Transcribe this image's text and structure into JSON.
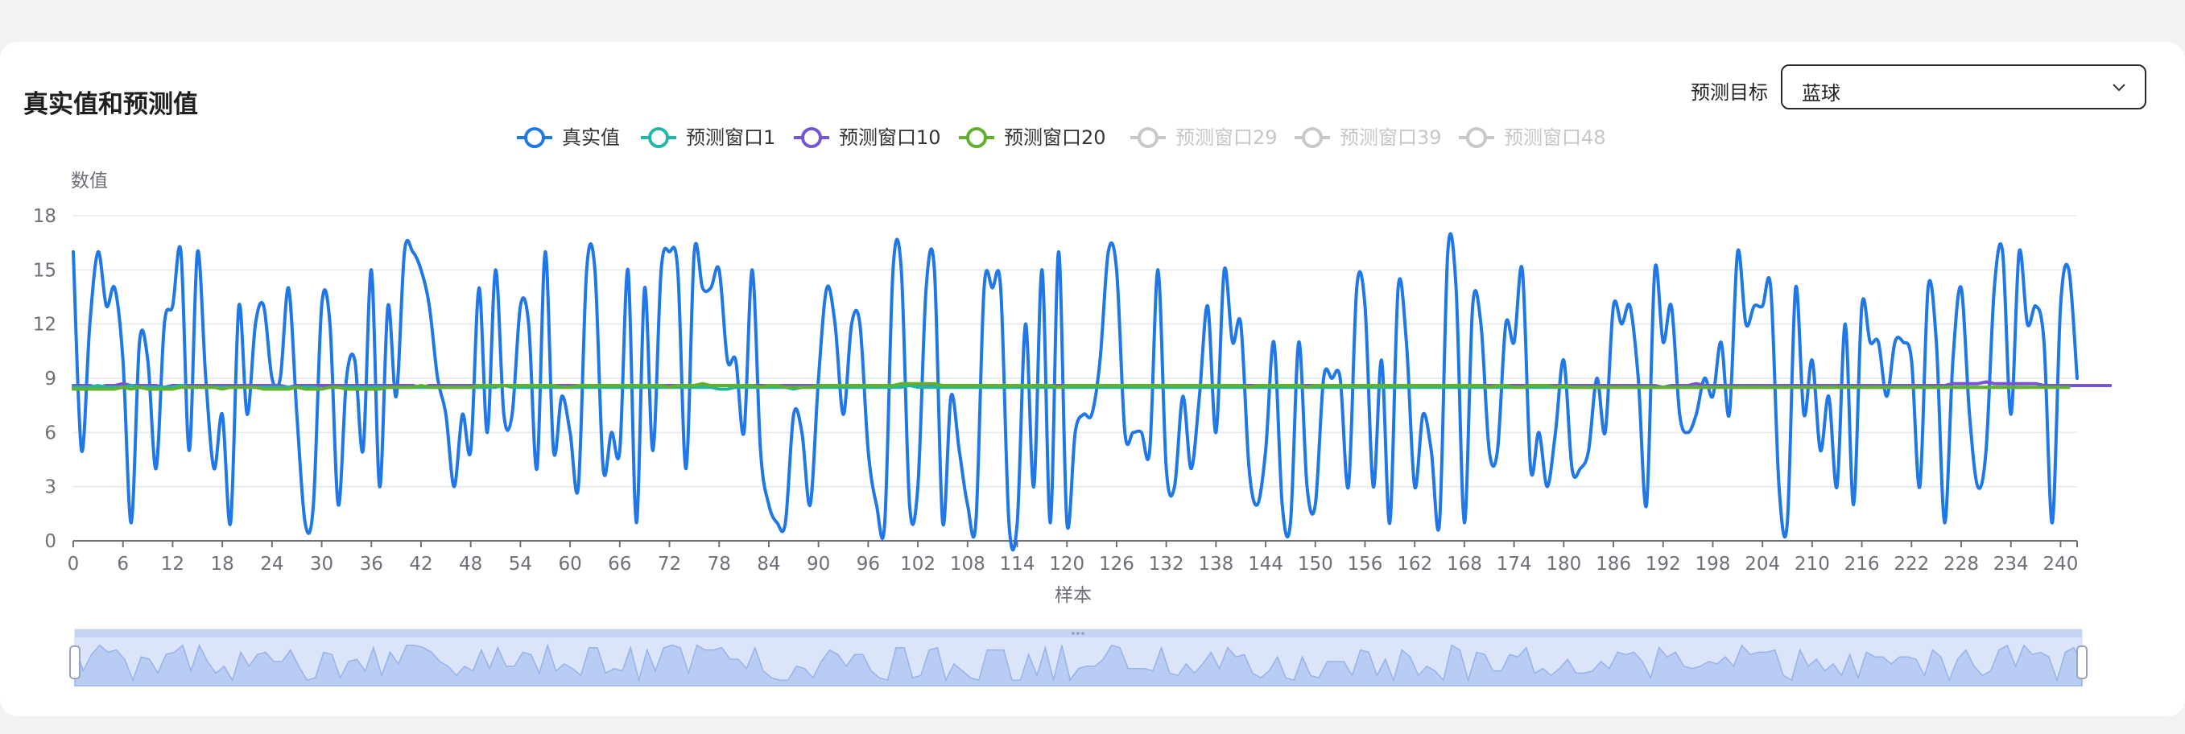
{
  "page": {
    "title": "真实值和预测值",
    "target_label": "预测目标",
    "target_value": "蓝球",
    "target_icon": "chevron-down-icon"
  },
  "colors": {
    "actual": "#1f78e6",
    "window1": "#20b8a5",
    "window10": "#7554d6",
    "window20": "#62b12c",
    "inactive": "#c8c8c8",
    "grid": "#e3e7f0",
    "axis": "#6e7079"
  },
  "chart_data": {
    "type": "line",
    "ylabel": "数值",
    "xlabel": "样本",
    "ylim": [
      0,
      18
    ],
    "yticks": [
      0,
      3,
      6,
      9,
      12,
      15,
      18
    ],
    "xlim": [
      0,
      242
    ],
    "xticks": [
      0,
      6,
      12,
      18,
      24,
      30,
      36,
      42,
      48,
      54,
      60,
      66,
      72,
      78,
      84,
      90,
      96,
      102,
      108,
      114,
      120,
      126,
      132,
      138,
      144,
      150,
      156,
      162,
      168,
      174,
      180,
      186,
      192,
      198,
      204,
      210,
      216,
      222,
      228,
      234,
      240
    ],
    "grid": true,
    "legend_position": "top-center",
    "legend": [
      {
        "name": "真实值",
        "active": true
      },
      {
        "name": "预测窗口1",
        "active": true
      },
      {
        "name": "预测窗口10",
        "active": true
      },
      {
        "name": "预测窗口20",
        "active": true
      },
      {
        "name": "预测窗口29",
        "active": false
      },
      {
        "name": "预测窗口39",
        "active": false
      },
      {
        "name": "预测窗口48",
        "active": false
      }
    ],
    "series": [
      {
        "name": "真实值",
        "values": [
          16,
          5,
          12,
          16,
          13,
          14,
          10,
          1,
          11,
          10,
          4,
          12,
          13,
          16,
          5,
          16,
          9,
          4,
          7,
          1,
          13,
          7,
          12,
          13,
          9,
          9,
          14,
          7,
          1,
          2,
          13,
          12,
          2,
          9,
          10,
          5,
          15,
          3,
          13,
          8,
          16,
          16,
          15,
          13,
          9,
          7,
          3,
          7,
          5,
          14,
          6,
          15,
          7,
          7,
          13,
          12,
          4,
          16,
          5,
          8,
          6,
          3,
          15,
          15,
          4,
          6,
          5,
          15,
          1,
          14,
          5,
          15,
          16,
          15,
          4,
          16,
          14,
          14,
          15,
          10,
          10,
          6,
          15,
          5,
          2,
          1,
          1,
          7,
          6,
          2,
          9,
          14,
          12,
          7,
          12,
          12,
          5,
          2,
          1,
          15,
          15,
          2,
          3,
          14,
          15,
          1,
          8,
          5,
          2,
          1,
          14,
          14,
          14,
          1,
          1,
          12,
          3,
          15,
          1,
          16,
          1,
          6,
          7,
          7,
          10,
          16,
          15,
          6,
          6,
          6,
          5,
          15,
          4,
          3,
          8,
          4,
          8,
          13,
          6,
          15,
          11,
          12,
          4,
          2,
          5,
          11,
          2,
          1,
          11,
          3,
          2,
          9,
          9,
          9,
          3,
          14,
          13,
          3,
          10,
          1,
          14,
          11,
          3,
          7,
          5,
          1,
          16,
          14,
          1,
          13,
          12,
          5,
          5,
          12,
          11,
          15,
          4,
          6,
          3,
          6,
          10,
          4,
          4,
          5,
          9,
          6,
          13,
          12,
          13,
          9,
          2,
          15,
          11,
          13,
          7,
          6,
          7,
          9,
          8,
          11,
          7,
          16,
          12,
          13,
          13,
          14,
          3,
          1,
          14,
          7,
          10,
          5,
          8,
          3,
          12,
          2,
          13,
          11,
          11,
          8,
          11,
          11,
          10,
          3,
          14,
          11,
          1,
          10,
          14,
          7,
          3,
          5,
          14,
          16,
          7,
          16,
          12,
          13,
          11,
          1,
          13,
          15,
          9
        ]
      },
      {
        "name": "预测窗口1",
        "values": [
          8.5,
          8.5,
          8.5,
          8.6,
          8.5,
          8.5,
          8.5,
          8.6,
          8.5,
          8.5,
          8.5,
          8.5,
          8.5,
          8.6,
          8.5,
          8.5,
          8.5,
          8.5,
          8.5,
          8.5,
          8.5,
          8.5,
          8.5,
          8.5,
          8.5,
          8.5,
          8.5,
          8.5,
          8.5,
          8.5,
          8.4,
          8.5,
          8.5,
          8.5,
          8.5,
          8.5,
          8.5,
          8.5,
          8.5,
          8.5,
          8.5,
          8.5,
          8.5,
          8.5,
          8.5,
          8.5,
          8.5,
          8.5,
          8.5,
          8.5,
          8.5,
          8.5,
          8.6,
          8.5,
          8.5,
          8.5,
          8.5,
          8.5,
          8.5,
          8.5,
          8.5,
          8.5,
          8.5,
          8.5,
          8.5,
          8.5,
          8.5,
          8.5,
          8.5,
          8.5,
          8.5,
          8.5,
          8.5,
          8.5,
          8.5,
          8.5,
          8.5,
          8.5,
          8.4,
          8.4,
          8.5,
          8.5,
          8.5,
          8.5,
          8.5,
          8.5,
          8.5,
          8.4,
          8.5,
          8.5,
          8.5,
          8.5,
          8.5,
          8.5,
          8.5,
          8.5,
          8.5,
          8.5,
          8.5,
          8.5,
          8.5,
          8.6,
          8.5,
          8.5,
          8.5,
          8.5,
          8.5,
          8.5,
          8.5,
          8.5,
          8.5,
          8.5,
          8.5,
          8.5,
          8.5,
          8.5,
          8.5,
          8.5,
          8.5,
          8.5,
          8.5,
          8.5,
          8.5,
          8.5,
          8.5,
          8.5,
          8.5,
          8.5,
          8.5,
          8.5,
          8.5,
          8.5,
          8.5,
          8.5,
          8.5,
          8.5,
          8.5,
          8.5,
          8.5,
          8.5,
          8.5,
          8.5,
          8.5,
          8.5,
          8.5,
          8.5,
          8.5,
          8.5,
          8.5,
          8.5,
          8.5,
          8.5,
          8.5,
          8.5,
          8.5,
          8.5,
          8.5,
          8.5,
          8.5,
          8.5,
          8.5,
          8.5,
          8.5,
          8.5,
          8.5,
          8.5,
          8.5,
          8.5,
          8.5,
          8.5,
          8.5,
          8.5,
          8.5,
          8.5,
          8.5,
          8.5,
          8.5,
          8.5,
          8.5,
          8.5,
          8.5,
          8.5,
          8.5,
          8.5,
          8.5,
          8.5,
          8.5,
          8.5,
          8.5,
          8.5,
          8.5,
          8.5,
          8.5,
          8.5,
          8.5,
          8.5,
          8.5,
          8.5,
          8.5,
          8.5,
          8.5,
          8.5,
          8.5,
          8.5,
          8.5,
          8.5,
          8.5,
          8.5,
          8.5,
          8.5,
          8.5,
          8.5,
          8.5,
          8.5,
          8.5,
          8.5,
          8.5,
          8.5,
          8.5,
          8.5,
          8.5,
          8.5,
          8.5,
          8.5,
          8.5,
          8.5,
          8.5,
          8.5,
          8.5,
          8.5,
          8.5,
          8.5,
          8.5,
          8.5,
          8.5,
          8.5,
          8.5
        ]
      },
      {
        "name": "预测窗口10",
        "values": [
          8.6,
          8.6,
          8.6,
          8.5,
          8.6,
          8.6,
          8.7,
          8.6,
          8.6,
          8.6,
          8.6,
          8.5,
          8.6,
          8.6,
          8.6,
          8.6,
          8.6,
          8.6,
          8.6,
          8.6,
          8.6,
          8.6,
          8.6,
          8.6,
          8.6,
          8.6,
          8.5,
          8.6,
          8.6,
          8.6,
          8.6,
          8.6,
          8.6,
          8.6,
          8.6,
          8.6,
          8.6,
          8.6,
          8.6,
          8.6,
          8.6,
          8.6,
          8.5,
          8.6,
          8.6,
          8.6,
          8.6,
          8.6,
          8.6,
          8.6,
          8.6,
          8.6,
          8.6,
          8.6,
          8.6,
          8.6,
          8.6,
          8.6,
          8.6,
          8.6,
          8.6,
          8.6,
          8.6,
          8.6,
          8.6,
          8.6,
          8.6,
          8.6,
          8.6,
          8.6,
          8.6,
          8.6,
          8.6,
          8.6,
          8.6,
          8.6,
          8.6,
          8.6,
          8.6,
          8.6,
          8.6,
          8.6,
          8.6,
          8.6,
          8.6,
          8.6,
          8.6,
          8.6,
          8.6,
          8.6,
          8.6,
          8.6,
          8.6,
          8.6,
          8.6,
          8.6,
          8.6,
          8.6,
          8.6,
          8.6,
          8.6,
          8.6,
          8.6,
          8.6,
          8.6,
          8.6,
          8.6,
          8.6,
          8.6,
          8.6,
          8.6,
          8.6,
          8.6,
          8.6,
          8.6,
          8.6,
          8.6,
          8.6,
          8.6,
          8.6,
          8.6,
          8.6,
          8.6,
          8.6,
          8.6,
          8.6,
          8.6,
          8.6,
          8.6,
          8.6,
          8.6,
          8.6,
          8.6,
          8.6,
          8.6,
          8.6,
          8.6,
          8.6,
          8.6,
          8.6,
          8.6,
          8.6,
          8.6,
          8.6,
          8.6,
          8.6,
          8.6,
          8.6,
          8.6,
          8.6,
          8.6,
          8.6,
          8.6,
          8.6,
          8.6,
          8.6,
          8.6,
          8.6,
          8.6,
          8.6,
          8.6,
          8.6,
          8.6,
          8.6,
          8.6,
          8.6,
          8.6,
          8.6,
          8.6,
          8.6,
          8.6,
          8.6,
          8.6,
          8.6,
          8.6,
          8.6,
          8.6,
          8.6,
          8.6,
          8.6,
          8.6,
          8.6,
          8.6,
          8.6,
          8.6,
          8.6,
          8.6,
          8.6,
          8.6,
          8.6,
          8.6,
          8.6,
          8.5,
          8.6,
          8.6,
          8.6,
          8.7,
          8.6,
          8.6,
          8.6,
          8.6,
          8.6,
          8.6,
          8.6,
          8.6,
          8.6,
          8.6,
          8.6,
          8.6,
          8.6,
          8.6,
          8.6,
          8.6,
          8.6,
          8.6,
          8.6,
          8.6,
          8.6,
          8.6,
          8.6,
          8.6,
          8.6,
          8.6,
          8.6,
          8.6,
          8.6,
          8.6,
          8.7,
          8.7,
          8.7,
          8.7,
          8.8,
          8.7,
          8.7,
          8.7,
          8.7,
          8.7,
          8.7,
          8.6,
          8.6,
          8.6,
          8.6,
          8.6,
          8.6,
          8.6,
          8.6,
          8.6
        ]
      },
      {
        "name": "预测窗口20",
        "values": [
          8.4,
          8.4,
          8.4,
          8.4,
          8.4,
          8.4,
          8.5,
          8.4,
          8.5,
          8.4,
          8.4,
          8.4,
          8.4,
          8.5,
          8.5,
          8.5,
          8.5,
          8.5,
          8.4,
          8.5,
          8.5,
          8.5,
          8.5,
          8.4,
          8.4,
          8.4,
          8.4,
          8.5,
          8.4,
          8.4,
          8.4,
          8.5,
          8.5,
          8.4,
          8.4,
          8.4,
          8.4,
          8.4,
          8.5,
          8.5,
          8.5,
          8.5,
          8.6,
          8.5,
          8.5,
          8.5,
          8.5,
          8.5,
          8.5,
          8.6,
          8.6,
          8.6,
          8.6,
          8.6,
          8.6,
          8.6,
          8.6,
          8.6,
          8.6,
          8.5,
          8.5,
          8.6,
          8.6,
          8.6,
          8.6,
          8.6,
          8.6,
          8.6,
          8.6,
          8.6,
          8.6,
          8.6,
          8.5,
          8.6,
          8.6,
          8.6,
          8.7,
          8.6,
          8.6,
          8.6,
          8.6,
          8.6,
          8.6,
          8.5,
          8.6,
          8.6,
          8.5,
          8.5,
          8.5,
          8.5,
          8.6,
          8.6,
          8.6,
          8.6,
          8.6,
          8.6,
          8.6,
          8.6,
          8.6,
          8.6,
          8.7,
          8.7,
          8.7,
          8.7,
          8.7,
          8.6,
          8.6,
          8.6,
          8.6,
          8.6,
          8.6,
          8.6,
          8.6,
          8.6,
          8.6,
          8.6,
          8.6,
          8.6,
          8.6,
          8.5,
          8.6,
          8.6,
          8.6,
          8.6,
          8.6,
          8.6,
          8.6,
          8.6,
          8.6,
          8.6,
          8.6,
          8.6,
          8.6,
          8.6,
          8.6,
          8.6,
          8.6,
          8.6,
          8.6,
          8.6,
          8.6,
          8.6,
          8.5,
          8.6,
          8.6,
          8.6,
          8.6,
          8.6,
          8.6,
          8.5,
          8.6,
          8.6,
          8.6,
          8.6,
          8.6,
          8.6,
          8.6,
          8.6,
          8.6,
          8.6,
          8.6,
          8.6,
          8.6,
          8.6,
          8.6,
          8.6,
          8.6,
          8.6,
          8.6,
          8.6,
          8.6,
          8.5,
          8.6,
          8.6,
          8.5,
          8.5,
          8.6,
          8.6,
          8.6,
          8.5,
          8.6,
          8.5,
          8.5,
          8.5,
          8.5,
          8.5,
          8.5,
          8.5,
          8.5,
          8.5,
          8.5,
          8.5,
          8.5,
          8.5,
          8.5,
          8.5,
          8.5,
          8.5,
          8.5,
          8.5,
          8.5,
          8.5,
          8.5,
          8.5,
          8.5,
          8.5,
          8.5,
          8.5,
          8.5,
          8.5,
          8.5,
          8.5,
          8.5,
          8.5,
          8.5,
          8.5,
          8.5,
          8.5,
          8.5,
          8.5,
          8.5,
          8.5,
          8.5,
          8.5,
          8.5,
          8.5,
          8.5,
          8.5,
          8.5,
          8.5,
          8.5,
          8.5,
          8.5,
          8.5,
          8.5,
          8.5,
          8.5,
          8.5,
          8.5,
          8.5,
          8.5,
          8.5
        ]
      }
    ]
  }
}
